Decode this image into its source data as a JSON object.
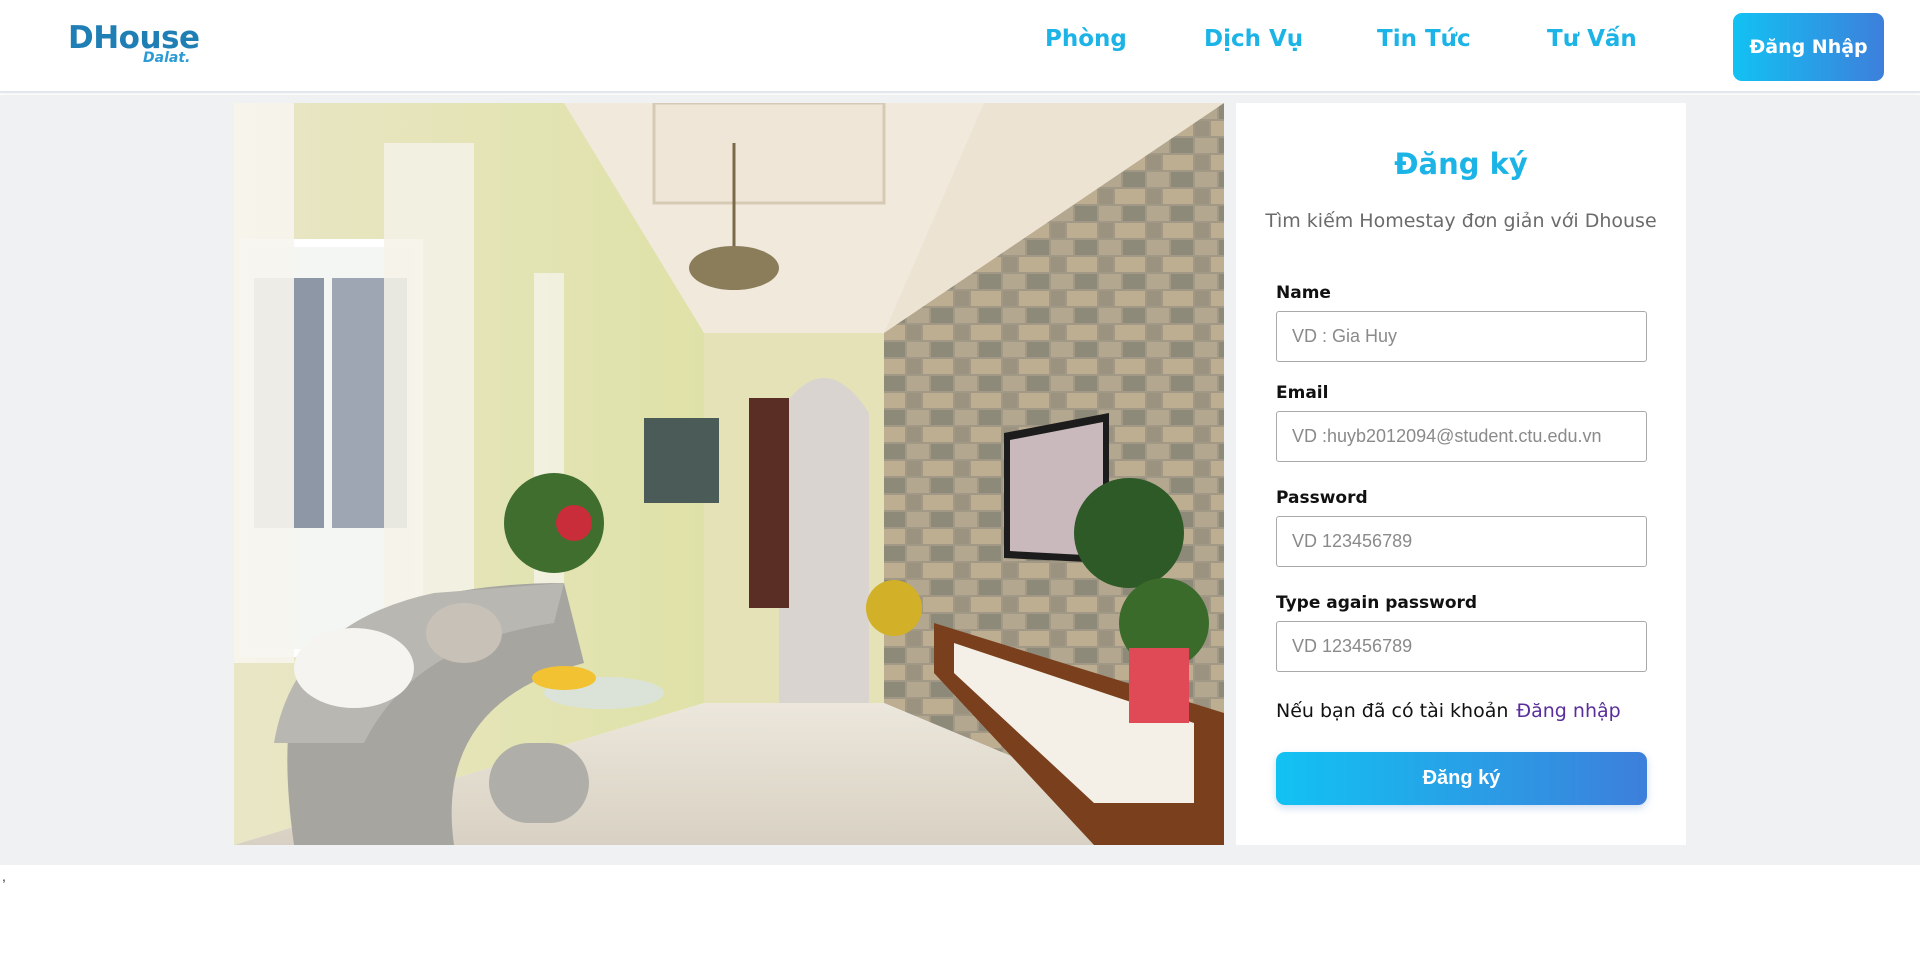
{
  "header": {
    "logo_main": "DHouse",
    "logo_sub": "Dalat.",
    "nav": [
      "Phòng",
      "Dịch Vụ",
      "Tin Tức",
      "Tư Vấn"
    ],
    "login_label": "Đăng Nhập"
  },
  "form": {
    "title": "Đăng ký",
    "subtitle": "Tìm kiếm Homestay đơn giản với Dhouse",
    "fields": [
      {
        "label": "Name",
        "placeholder": "VD : Gia Huy",
        "value": ""
      },
      {
        "label": "Email",
        "placeholder": "VD :huyb2012094@student.ctu.edu.vn",
        "value": ""
      },
      {
        "label": "Password",
        "placeholder": "VD 123456789",
        "value": ""
      },
      {
        "label": "Type again password",
        "placeholder": "VD 123456789",
        "value": ""
      }
    ],
    "already_text": "Nếu bạn đã có tài khoản",
    "already_link": "Đăng nhập",
    "submit_label": "Đăng ký"
  },
  "stray_text": ",",
  "colors": {
    "accent": "#1cb4e6",
    "gradient_start": "#12c2f3",
    "gradient_end": "#3d7fdb",
    "logo": "#1f7fb5",
    "link": "#5a2e9a",
    "band_bg": "#f0f1f2"
  }
}
